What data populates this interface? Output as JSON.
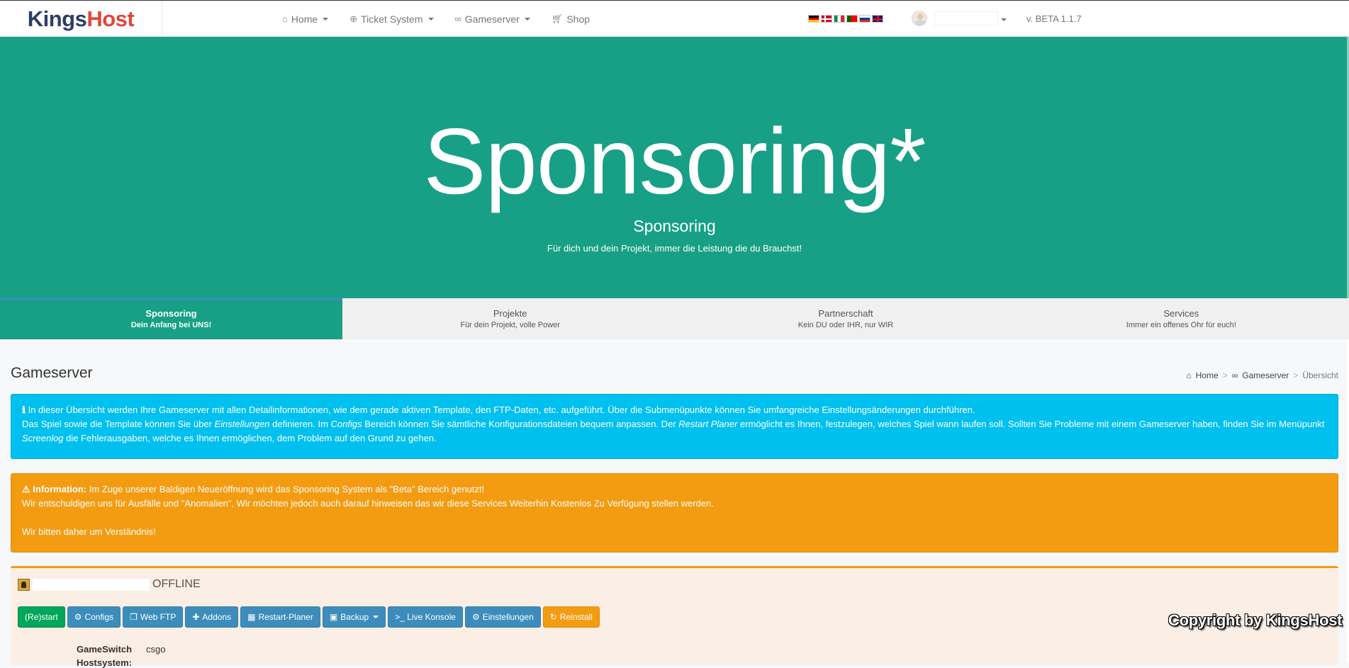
{
  "brand": {
    "logo_part1": "Kings",
    "logo_part2": "Host"
  },
  "nav": [
    {
      "label": "Home",
      "icon": "home-icon"
    },
    {
      "label": "Ticket System",
      "icon": "lifebuoy-icon"
    },
    {
      "label": "Gameserver",
      "icon": "gamepad-icon"
    },
    {
      "label": "Shop",
      "icon": "cart-icon"
    }
  ],
  "languages": [
    "de",
    "dk",
    "it",
    "pt",
    "ru",
    "gb"
  ],
  "version": "v. BETA 1.1.7",
  "hero": {
    "big": "Sponsoring*",
    "sub": "Sponsoring",
    "tag": "Für dich und dein Projekt, immer die Leistung die du Brauchst!",
    "color": "#17a085"
  },
  "tabs": [
    {
      "title": "Sponsoring",
      "subtitle": "Dein Anfang bei UNS!",
      "active": true
    },
    {
      "title": "Projekte",
      "subtitle": "Für dein Projekt, volle Power"
    },
    {
      "title": "Partnerschaft",
      "subtitle": "Kein DU oder IHR, nur WIR"
    },
    {
      "title": "Services",
      "subtitle": "Immer ein offenes Ohr für euch!"
    }
  ],
  "page": {
    "title": "Gameserver",
    "breadcrumb": {
      "home": "Home",
      "section": "Gameserver",
      "current": "Übersicht",
      "sep": ">"
    }
  },
  "info_alert": {
    "line1": "In dieser Übersicht werden Ihre Gameserver mit allen Detailinformationen, wie dem gerade aktiven Template, den FTP-Daten, etc. aufgeführt. Über die Submenüpunkte können Sie umfangreiche Einstellungsänderungen durchführen.",
    "l2_a": "Das Spiel sowie die Template können Sie über ",
    "l2_b": "Einstellungen",
    "l2_c": " definieren. Im ",
    "l2_d": "Configs",
    "l2_e": " Bereich können Sie sämtliche Konfigurationsdateien bequem anpassen. Der ",
    "l2_f": "Restart Planer",
    "l2_g": " ermöglicht es Ihnen, festzulegen, welches Spiel wann laufen soll. Sollten Sie Probleme mit einem Gameserver haben, finden Sie im Menüpunkt ",
    "l2_h": "Screenlog",
    "l2_i": " die Fehlerausgaben, welche es Ihnen ermöglichen, dem Problem auf den Grund zu gehen."
  },
  "warn_alert": {
    "label": "Information:",
    "line1": " Im Zuge unserer Baldigen Neueröffnung wird das Sponsoring System als \"Beta\" Bereich genutzt!",
    "line2": "Wir entschuldigen uns für Ausfälle und \"Anomalien\", Wir möchten jedoch auch darauf hinweisen das wir diese Services Weiterhin Kostenlos Zu Verfügung stellen werden.",
    "line3": "Wir bitten daher um Verständnis!"
  },
  "server": {
    "status": "OFFLINE",
    "buttons": {
      "restart": "(Re)start",
      "configs": "Configs",
      "webftp": "Web FTP",
      "addons": "Addons",
      "restart_planer": "Restart-Planer",
      "backup": "Backup",
      "live_console": ">_ Live Konsole",
      "settings": "Einstellungen",
      "reinstall": "Reinstall"
    },
    "details": [
      {
        "key": "GameSwitch",
        "value": "csgo"
      },
      {
        "key": "Hostsystem:",
        "value": ""
      }
    ]
  },
  "copyright": "Copyright by KingsHost"
}
